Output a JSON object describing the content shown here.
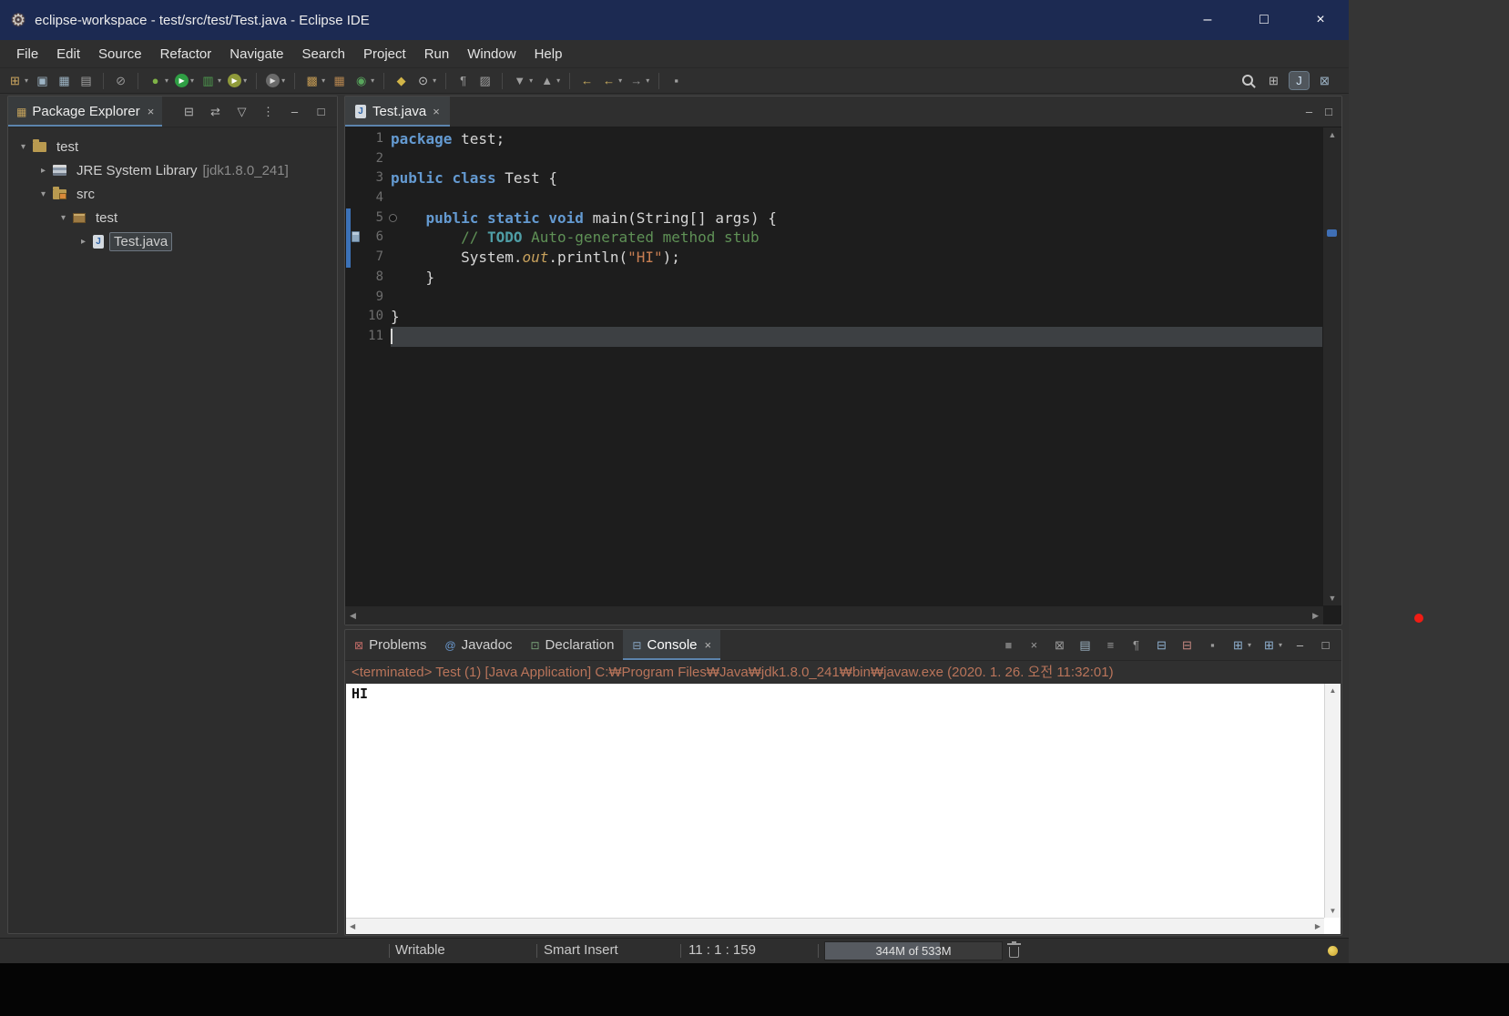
{
  "window": {
    "title": "eclipse-workspace - test/src/test/Test.java - Eclipse IDE",
    "controls": [
      {
        "name": "minimize",
        "glyph": "–"
      },
      {
        "name": "maximize",
        "glyph": "□"
      },
      {
        "name": "close",
        "glyph": "×"
      }
    ]
  },
  "menubar": [
    "File",
    "Edit",
    "Source",
    "Refactor",
    "Navigate",
    "Search",
    "Project",
    "Run",
    "Window",
    "Help"
  ],
  "toolbar": {
    "left": [
      {
        "name": "new",
        "glyph": "⊞",
        "color": "#cba55e",
        "dd": true
      },
      {
        "name": "save",
        "glyph": "▣",
        "color": "#9db4c4"
      },
      {
        "name": "save-all",
        "glyph": "▦",
        "color": "#9db4c4"
      },
      {
        "name": "print",
        "glyph": "▤",
        "color": "#a3a3a3"
      },
      {
        "sep": true
      },
      {
        "name": "skip-breakpoints",
        "glyph": "⊘",
        "color": "#9a9a9a"
      },
      {
        "sep": true
      },
      {
        "name": "debug",
        "glyph": "●",
        "color": "#7fb347",
        "dd": true
      },
      {
        "name": "run",
        "glyph": "▶",
        "bg": "#2f9e44",
        "color": "#ffffff",
        "dd": true
      },
      {
        "name": "coverage",
        "glyph": "▥",
        "color": "#4f9e4f",
        "dd": true
      },
      {
        "name": "profile",
        "glyph": "▶",
        "bg": "#8f9a3a",
        "color": "#ffffff",
        "dd": true
      },
      {
        "sep": true
      },
      {
        "name": "external-tools",
        "glyph": "▶",
        "bg": "#6a6a6a",
        "color": "#e0e0e0",
        "dd": true
      },
      {
        "sep": true
      },
      {
        "name": "new-java-project",
        "glyph": "▩",
        "color": "#c09853",
        "dd": true
      },
      {
        "name": "new-package",
        "glyph": "▦",
        "color": "#b5854f"
      },
      {
        "name": "new-class",
        "glyph": "◉",
        "color": "#58a55c",
        "dd": true
      },
      {
        "sep": true
      },
      {
        "name": "open-type",
        "glyph": "◆",
        "color": "#d2b548"
      },
      {
        "name": "search",
        "glyph": "⊙",
        "color": "#c9c9c9",
        "dd": true
      },
      {
        "sep": true
      },
      {
        "name": "show-whitespace",
        "glyph": "¶",
        "color": "#9f9f9f"
      },
      {
        "name": "mark-occurrences",
        "glyph": "▨",
        "color": "#9f9f9f"
      },
      {
        "sep": true
      },
      {
        "name": "next-annotation",
        "glyph": "▼",
        "color": "#9f9f9f",
        "dd": true
      },
      {
        "name": "previous-annotation",
        "glyph": "▲",
        "color": "#9f9f9f",
        "dd": true
      },
      {
        "sep": true
      },
      {
        "name": "last-edit-location",
        "glyph": "←",
        "color": "#d3b461"
      },
      {
        "name": "back",
        "glyph": "←",
        "color": "#d3b461",
        "dd": true
      },
      {
        "name": "forward",
        "glyph": "→",
        "color": "#8f8f8f",
        "dd": true
      },
      {
        "sep": true
      },
      {
        "name": "pin-editor",
        "glyph": "▪",
        "color": "#9f9f9f"
      }
    ],
    "right": [
      {
        "name": "quick-access-search",
        "glyph": "",
        "cls": "mag"
      },
      {
        "name": "open-perspective",
        "glyph": "⊞",
        "color": "#bcbcbc"
      },
      {
        "name": "java-perspective",
        "glyph": "J",
        "color": "#cfe3f5",
        "active": true
      },
      {
        "name": "debug-perspective",
        "glyph": "⊠",
        "color": "#9fb6c9"
      }
    ]
  },
  "package_explorer": {
    "tab_icon": "▦",
    "tab_label": "Package Explorer",
    "close_glyph": "×",
    "toolbar": [
      {
        "name": "collapse-all",
        "glyph": "⊟",
        "color": "#b5b5b5"
      },
      {
        "name": "link-with-editor",
        "glyph": "⇄",
        "color": "#b5b5b5"
      },
      {
        "name": "filters",
        "glyph": "▽",
        "color": "#b5b5b5"
      },
      {
        "name": "view-menu",
        "glyph": "⋮",
        "color": "#b5b5b5"
      },
      {
        "name": "minimize-view",
        "glyph": "–",
        "color": "#c5c5c5"
      },
      {
        "name": "maximize-view",
        "glyph": "□",
        "color": "#c5c5c5"
      }
    ],
    "tree": [
      {
        "name": "project-test",
        "label": "test",
        "depth": 0,
        "arrow": "▾",
        "icon": "project"
      },
      {
        "name": "jre-system-library",
        "label": "JRE System Library",
        "suffix": "[jdk1.8.0_241]",
        "depth": 1,
        "arrow": "▸",
        "icon": "library"
      },
      {
        "name": "src-folder",
        "label": "src",
        "depth": 1,
        "arrow": "▾",
        "icon": "src"
      },
      {
        "name": "package-test",
        "label": "test",
        "depth": 2,
        "arrow": "▾",
        "icon": "package"
      },
      {
        "name": "file-test-java",
        "label": "Test.java",
        "depth": 3,
        "arrow": "▸",
        "icon": "jfile",
        "selected": true
      }
    ]
  },
  "editor": {
    "tab": {
      "icon_letter": "J",
      "label": "Test.java",
      "close_glyph": "×"
    },
    "controls": [
      {
        "name": "minimize-editor",
        "glyph": "–"
      },
      {
        "name": "maximize-editor",
        "glyph": "□"
      }
    ],
    "lines": [
      {
        "n": 1,
        "seg": [
          [
            "kw",
            "package"
          ],
          [
            "pl",
            " test;"
          ]
        ]
      },
      {
        "n": 2,
        "seg": []
      },
      {
        "n": 3,
        "seg": [
          [
            "kw",
            "public"
          ],
          [
            "pl",
            " "
          ],
          [
            "kw",
            "class"
          ],
          [
            "pl",
            " Test {"
          ]
        ]
      },
      {
        "n": 4,
        "seg": []
      },
      {
        "n": 5,
        "seg": [
          [
            "pl",
            "    "
          ],
          [
            "kw",
            "public"
          ],
          [
            "pl",
            " "
          ],
          [
            "kw",
            "static"
          ],
          [
            "pl",
            " "
          ],
          [
            "kw",
            "void"
          ],
          [
            "pl",
            " main(String[] args) {"
          ]
        ],
        "dot": true,
        "range": true
      },
      {
        "n": 6,
        "seg": [
          [
            "pl",
            "        "
          ],
          [
            "cm",
            "// "
          ],
          [
            "todo",
            "TODO"
          ],
          [
            "cm",
            " Auto-generated method stub"
          ]
        ],
        "task": true,
        "range": true
      },
      {
        "n": 7,
        "seg": [
          [
            "pl",
            "        System."
          ],
          [
            "field",
            "out"
          ],
          [
            "pl",
            ".println("
          ],
          [
            "str",
            "\"HI\""
          ],
          [
            "pl",
            ");"
          ]
        ],
        "range": true
      },
      {
        "n": 8,
        "seg": [
          [
            "pl",
            "    }"
          ]
        ]
      },
      {
        "n": 9,
        "seg": []
      },
      {
        "n": 10,
        "seg": [
          [
            "pl",
            "}"
          ]
        ]
      },
      {
        "n": 11,
        "seg": [],
        "current": true
      }
    ]
  },
  "console": {
    "tabs": [
      {
        "name": "problems",
        "label": "Problems",
        "glyph": "⊠",
        "color": "#bd6a66"
      },
      {
        "name": "javadoc",
        "label": "Javadoc",
        "glyph": "@",
        "color": "#6b9bd2"
      },
      {
        "name": "declaration",
        "label": "Declaration",
        "glyph": "⊡",
        "color": "#7aa37a"
      },
      {
        "name": "console",
        "label": "Console",
        "glyph": "⊟",
        "color": "#87a5c4",
        "active": true,
        "close": "×"
      }
    ],
    "toolbar": [
      {
        "name": "terminate",
        "glyph": "■",
        "color": "#787878"
      },
      {
        "name": "remove-launch",
        "glyph": "×",
        "color": "#9a9a9a"
      },
      {
        "name": "remove-all-launches",
        "glyph": "⊠",
        "color": "#9a9a9a"
      },
      {
        "name": "clear-console",
        "glyph": "▤",
        "color": "#9db4c4"
      },
      {
        "name": "scroll-lock",
        "glyph": "≡",
        "color": "#9a9a9a"
      },
      {
        "name": "word-wrap",
        "glyph": "¶",
        "color": "#9a9a9a"
      },
      {
        "name": "show-stdout",
        "glyph": "⊟",
        "color": "#8fb0d0"
      },
      {
        "name": "show-stderr",
        "glyph": "⊟",
        "color": "#c88a82"
      },
      {
        "name": "pin-console",
        "glyph": "▪",
        "color": "#9a9a9a"
      },
      {
        "name": "display-selected-console",
        "glyph": "⊞",
        "color": "#8fb0d0",
        "dd": true
      },
      {
        "name": "open-console",
        "glyph": "⊞",
        "color": "#8fb0d0",
        "dd": true
      },
      {
        "name": "minimize-view",
        "glyph": "–",
        "color": "#c5c5c5"
      },
      {
        "name": "maximize-view",
        "glyph": "□",
        "color": "#c5c5c5"
      }
    ],
    "header": "<terminated> Test (1) [Java Application] C:₩Program Files₩Java₩jdk1.8.0_241₩bin₩javaw.exe (2020. 1. 26. 오전 11:32:01)",
    "output": "HI"
  },
  "statusbar": {
    "writable": "Writable",
    "input_mode": "Smart Insert",
    "caret_position": "11 : 1 : 159",
    "heap": {
      "text": "344M of 533M",
      "fraction": 0.645
    }
  }
}
